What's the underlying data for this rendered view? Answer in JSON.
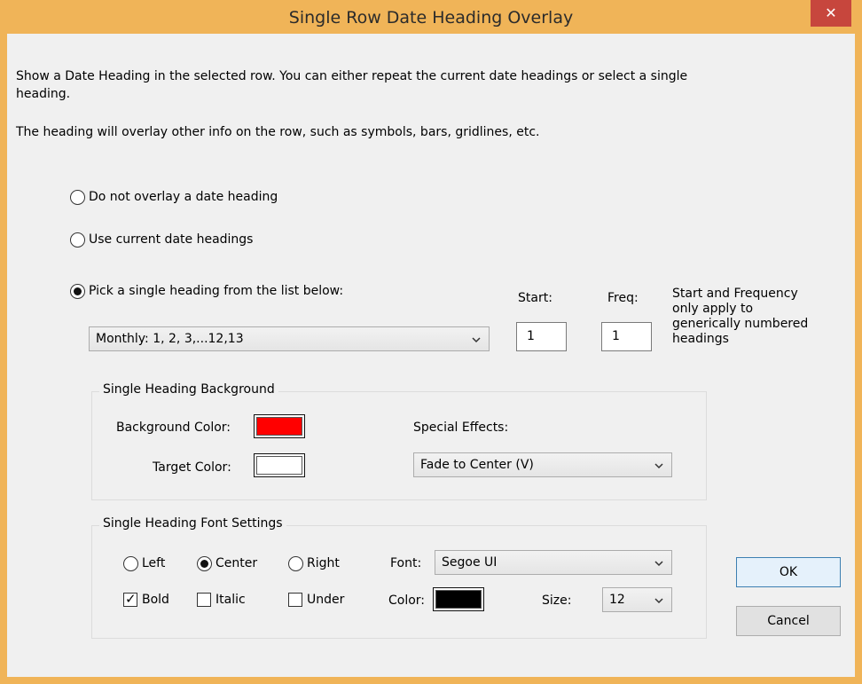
{
  "window": {
    "title": "Single Row Date Heading Overlay",
    "close_label": "✕"
  },
  "description": {
    "line1": "Show a Date Heading in the selected row. You can either repeat the current date headings or select a single",
    "line1b": "heading.",
    "line2": "The heading will overlay other info on the row, such as symbols, bars, gridlines, etc."
  },
  "options": {
    "none_label": "Do not overlay a date heading",
    "current_label": "Use current date headings",
    "single_label": "Pick a single heading from the list below:",
    "selected": "single"
  },
  "heading_select": {
    "value": "Monthly: 1, 2, 3,...12,13"
  },
  "start": {
    "label": "Start:",
    "value": "1"
  },
  "freq": {
    "label": "Freq:",
    "value": "1"
  },
  "note": [
    "Start and Frequency",
    "only apply to",
    "generically numbered",
    "headings"
  ],
  "background_group": {
    "title": "Single Heading Background",
    "bg_color_label": "Background Color:",
    "bg_color": "#ff0000",
    "target_color_label": "Target Color:",
    "target_color": "#ffffff",
    "effects_label": "Special Effects:",
    "effects_value": "Fade to Center (V)"
  },
  "font_group": {
    "title": "Single Heading Font Settings",
    "align_left": "Left",
    "align_center": "Center",
    "align_right": "Right",
    "alignment": "center",
    "bold_label": "Bold",
    "italic_label": "Italic",
    "under_label": "Under",
    "bold": true,
    "italic": false,
    "under": false,
    "font_label": "Font:",
    "font_value": "Segoe UI",
    "color_label": "Color:",
    "color": "#000000",
    "size_label": "Size:",
    "size_value": "12"
  },
  "buttons": {
    "ok": "OK",
    "cancel": "Cancel"
  },
  "theme": {
    "title_bar": "#f0b458",
    "close_button": "#c7463d",
    "client": "#f0f0f0"
  }
}
